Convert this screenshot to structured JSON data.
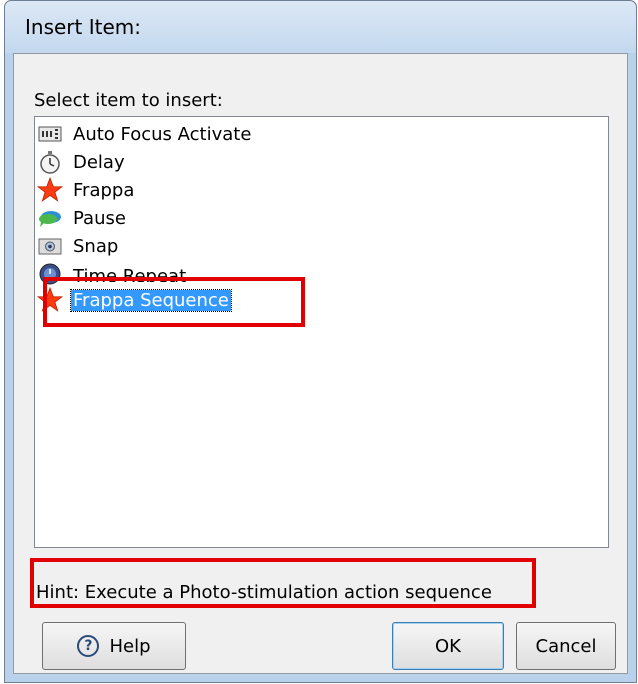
{
  "window": {
    "title": "Insert Item:"
  },
  "dialog": {
    "prompt": "Select item to insert:"
  },
  "list": {
    "items": [
      {
        "label": "Auto Focus Activate",
        "icon": "numeric-display-icon"
      },
      {
        "label": "Delay",
        "icon": "stopwatch-icon"
      },
      {
        "label": "Frappa",
        "icon": "red-star-icon"
      },
      {
        "label": "Pause",
        "icon": "chat-bubble-icon"
      },
      {
        "label": "Snap",
        "icon": "camera-icon"
      },
      {
        "label": "Time Repeat",
        "icon": "clock-repeat-icon"
      },
      {
        "label": "Frappa Sequence",
        "icon": "red-star-icon"
      }
    ],
    "selected_index": 6
  },
  "hint": {
    "text": "Hint: Execute a Photo-stimulation action sequence"
  },
  "buttons": {
    "help": "Help",
    "ok": "OK",
    "cancel": "Cancel"
  },
  "colors": {
    "highlight": "#e00000",
    "selection": "#3399ff",
    "window_frame": "#b9d1ea"
  }
}
